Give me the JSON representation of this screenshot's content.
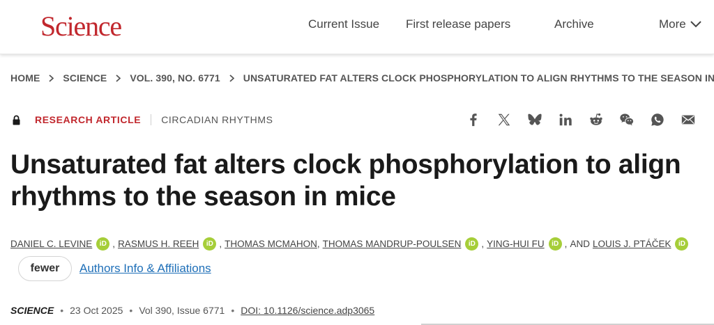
{
  "header": {
    "logo": "Science",
    "nav": [
      "Current Issue",
      "First release papers",
      "Archive"
    ],
    "more_label": "More"
  },
  "breadcrumb": [
    "HOME",
    "SCIENCE",
    "VOL. 390, NO. 6771",
    "UNSATURATED FAT ALTERS CLOCK PHOSPHORYLATION TO ALIGN RHYTHMS TO THE SEASON IN…"
  ],
  "article": {
    "type": "RESEARCH ARTICLE",
    "subject": "CIRCADIAN RHYTHMS",
    "title": "Unsaturated fat alters clock phosphorylation to align rhythms to the season in mice",
    "authors": [
      "DANIEL C. LEVINE",
      "RASMUS H. REEH",
      "THOMAS MCMAHON",
      "THOMAS MANDRUP-POULSEN",
      "YING-HUI FU",
      "LOUIS J. PTÁČEK"
    ],
    "and_label": "AND",
    "orcid_label": "iD",
    "fewer_label": "fewer",
    "affiliations_label": "Authors Info & Affiliations"
  },
  "citation": {
    "journal": "SCIENCE",
    "date": "23 Oct 2025",
    "volume": "Vol 390, Issue 6771",
    "doi": "DOI: 10.1126/science.adp3065"
  },
  "share_icons": [
    "facebook-icon",
    "x-icon",
    "bluesky-icon",
    "linkedin-icon",
    "reddit-icon",
    "wechat-icon",
    "whatsapp-icon",
    "email-icon"
  ],
  "colors": {
    "brand": "#c1272d",
    "link": "#1e6fb8",
    "orcid": "#a6ce39"
  }
}
